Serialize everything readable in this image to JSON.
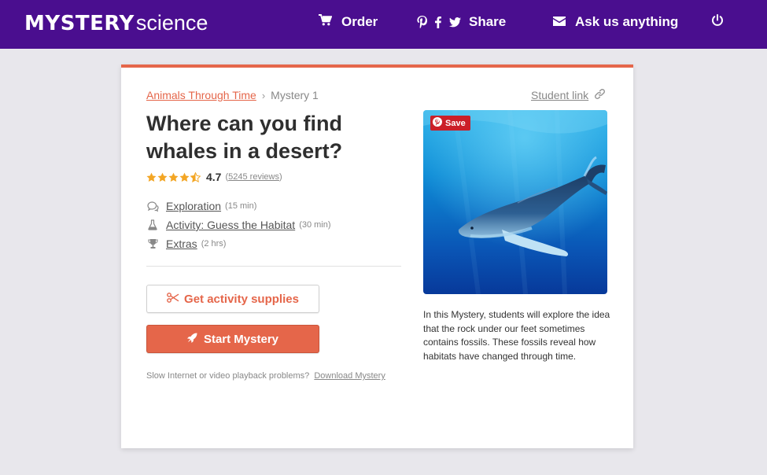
{
  "header": {
    "logo_bold": "MYSTERY",
    "logo_light": "science",
    "order_label": "Order",
    "share_label": "Share",
    "ask_label": "Ask us anything",
    "background_color": "#4a0e8f",
    "icons": [
      "cart-icon",
      "pinterest-icon",
      "facebook-icon",
      "twitter-icon",
      "envelope-icon",
      "power-icon"
    ]
  },
  "breadcrumb": {
    "unit": "Animals Through Time",
    "separator": "›",
    "current": "Mystery 1"
  },
  "student_link": "Student link",
  "mystery": {
    "title": "Where can you find whales in a desert?",
    "rating": "4.7",
    "rating_stars": 4.5,
    "reviews_paren_open": "(",
    "reviews": "5245 reviews",
    "reviews_paren_close": ")",
    "sections": [
      {
        "label": "Exploration",
        "duration": "(15 min)",
        "icon": "speech-bubbles-icon"
      },
      {
        "label": "Activity: Guess the Habitat",
        "duration": "(30 min)",
        "icon": "flask-icon"
      },
      {
        "label": "Extras",
        "duration": "(2 hrs)",
        "icon": "trophy-icon"
      }
    ]
  },
  "buttons": {
    "supplies": "Get activity supplies",
    "start": "Start Mystery"
  },
  "slow_note": {
    "text": "Slow Internet or video playback problems?",
    "link": "Download Mystery"
  },
  "image": {
    "save_label": "Save"
  },
  "description": "In this Mystery, students will explore the idea that the rock under our feet sometimes contains fossils. These fossils reveal how habitats have changed through time.",
  "colors": {
    "accent": "#e5664a",
    "star": "#f3a625",
    "pin_red": "#cb1f28"
  }
}
